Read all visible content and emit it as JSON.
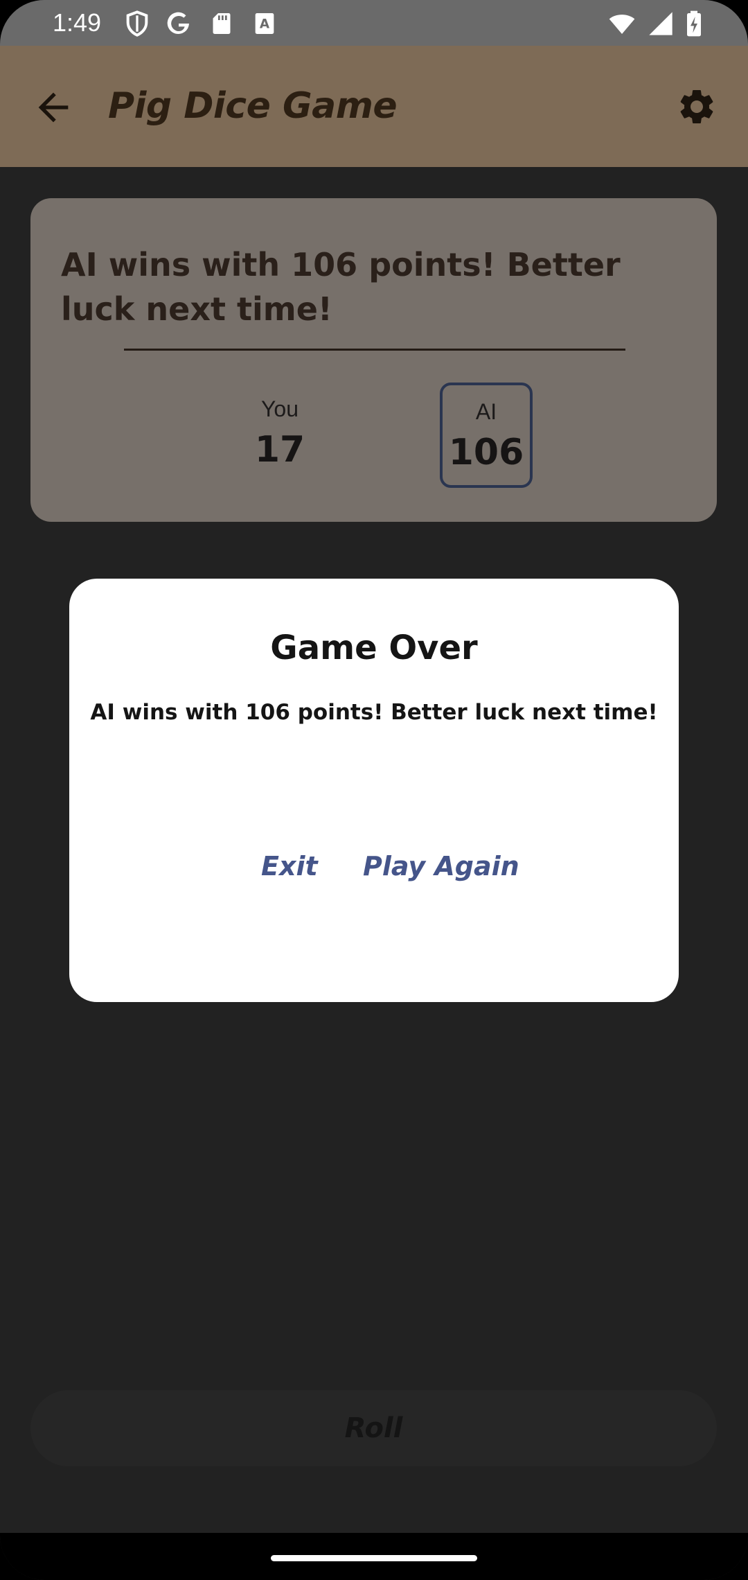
{
  "status_bar": {
    "time": "1:49",
    "icons": [
      "shield-icon",
      "google-icon",
      "sd-card-icon",
      "keyboard-icon",
      "wifi-icon",
      "cell-signal-icon",
      "battery-charging-icon"
    ]
  },
  "app_bar": {
    "title": "Pig Dice Game",
    "back_icon": "arrow-back-icon",
    "settings_icon": "gear-icon",
    "background_color": "#7e6b56"
  },
  "score_card": {
    "message": "AI wins with 106 points! Better luck next time!",
    "players": [
      {
        "label": "You",
        "score": "17",
        "active": false
      },
      {
        "label": "AI",
        "score": "106",
        "active": true
      }
    ]
  },
  "dialog": {
    "title": "Game Over",
    "message": "AI wins with 106 points! Better luck next time!",
    "buttons": {
      "exit": "Exit",
      "play_again": "Play Again"
    },
    "button_color": "#45558a"
  },
  "roll_button": {
    "label": "Roll"
  }
}
